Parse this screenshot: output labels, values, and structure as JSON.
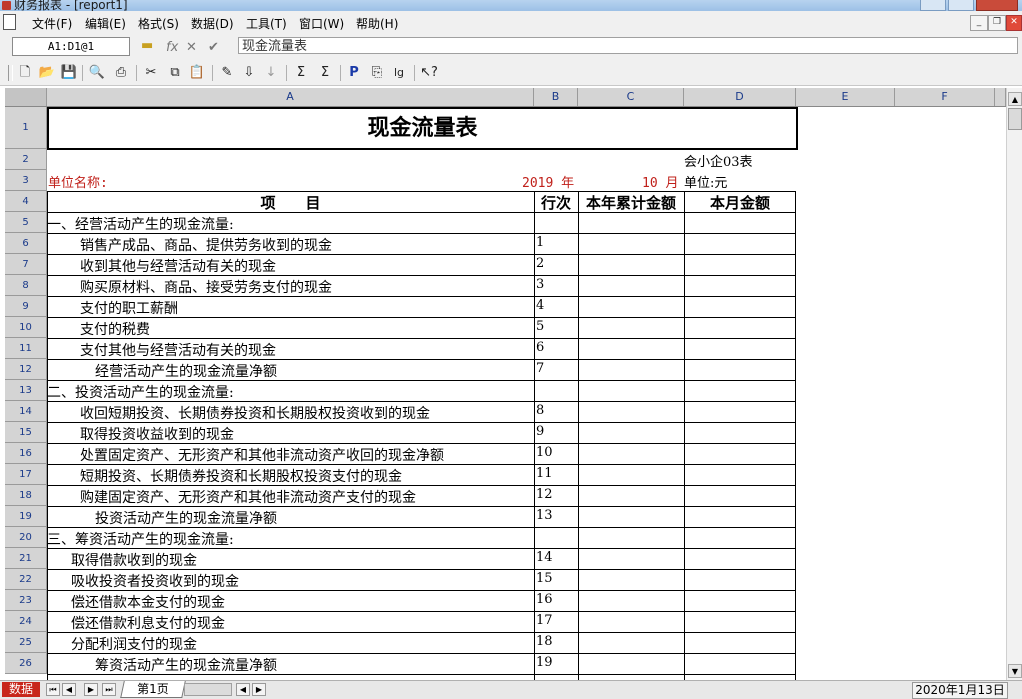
{
  "window": {
    "title": "财务报表 - [report1]"
  },
  "menu": [
    "文件(F)",
    "编辑(E)",
    "格式(S)",
    "数据(D)",
    "工具(T)",
    "窗口(W)",
    "帮助(H)"
  ],
  "formula_bar": {
    "cell_ref": "A1:D1@1",
    "content": "现金流量表"
  },
  "toolbar_icons": [
    "new-icon",
    "open-icon",
    "save-icon",
    "print-preview-icon",
    "print-icon",
    "cut-icon",
    "copy-icon",
    "paste-icon",
    "fill-icon",
    "insert-icon",
    "sort-icon",
    "sum-icon",
    "sigma-icon",
    "p-icon",
    "page-icon",
    "log-icon",
    "help-icon"
  ],
  "columns": [
    "A",
    "B",
    "C",
    "D",
    "E",
    "F"
  ],
  "report": {
    "title": "现金流量表",
    "form_no": "会小企03表",
    "unit_label": "单位名称:",
    "year": "2019 年",
    "month": "10 月",
    "currency": "单位:元",
    "headers": {
      "item": "项　　目",
      "line": "行次",
      "ytd": "本年累计金额",
      "month": "本月金额"
    },
    "rows": [
      {
        "r": "5",
        "item": "一、经营活动产生的现金流量:",
        "line": "",
        "indent": 0
      },
      {
        "r": "6",
        "item": "销售产成品、商品、提供劳务收到的现金",
        "line": "1",
        "indent": 2
      },
      {
        "r": "7",
        "item": "收到其他与经营活动有关的现金",
        "line": "2",
        "indent": 2
      },
      {
        "r": "8",
        "item": "购买原材料、商品、接受劳务支付的现金",
        "line": "3",
        "indent": 2
      },
      {
        "r": "9",
        "item": "支付的职工薪酬",
        "line": "4",
        "indent": 2
      },
      {
        "r": "10",
        "item": "支付的税费",
        "line": "5",
        "indent": 2
      },
      {
        "r": "11",
        "item": "支付其他与经营活动有关的现金",
        "line": "6",
        "indent": 2
      },
      {
        "r": "12",
        "item": "经营活动产生的现金流量净额",
        "line": "7",
        "indent": 3
      },
      {
        "r": "13",
        "item": "二、投资活动产生的现金流量:",
        "line": "",
        "indent": 0
      },
      {
        "r": "14",
        "item": "收回短期投资、长期债券投资和长期股权投资收到的现金",
        "line": "8",
        "indent": 2
      },
      {
        "r": "15",
        "item": "取得投资收益收到的现金",
        "line": "9",
        "indent": 2
      },
      {
        "r": "16",
        "item": "处置固定资产、无形资产和其他非流动资产收回的现金净额",
        "line": "10",
        "indent": 2
      },
      {
        "r": "17",
        "item": "短期投资、长期债券投资和长期股权投资支付的现金",
        "line": "11",
        "indent": 2
      },
      {
        "r": "18",
        "item": "购建固定资产、无形资产和其他非流动资产支付的现金",
        "line": "12",
        "indent": 2
      },
      {
        "r": "19",
        "item": "投资活动产生的现金流量净额",
        "line": "13",
        "indent": 3
      },
      {
        "r": "20",
        "item": "三、筹资活动产生的现金流量:",
        "line": "",
        "indent": 0
      },
      {
        "r": "21",
        "item": "取得借款收到的现金",
        "line": "14",
        "indent": 1
      },
      {
        "r": "22",
        "item": "吸收投资者投资收到的现金",
        "line": "15",
        "indent": 1
      },
      {
        "r": "23",
        "item": "偿还借款本金支付的现金",
        "line": "16",
        "indent": 1
      },
      {
        "r": "24",
        "item": "偿还借款利息支付的现金",
        "line": "17",
        "indent": 1
      },
      {
        "r": "25",
        "item": "分配利润支付的现金",
        "line": "18",
        "indent": 1
      },
      {
        "r": "26",
        "item": "筹资活动产生的现金流量净额",
        "line": "19",
        "indent": 3
      }
    ]
  },
  "status": {
    "mode": "数据",
    "sheet": "第1页",
    "date": "2020年1月13日"
  }
}
